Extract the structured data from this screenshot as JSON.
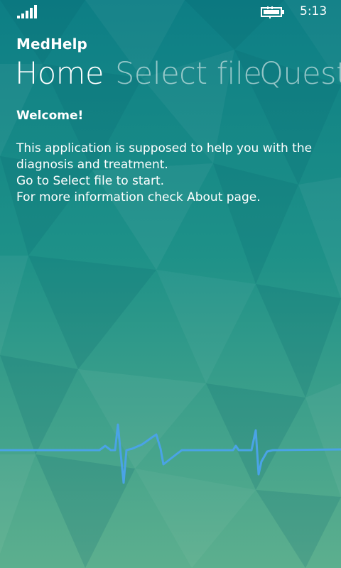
{
  "status_bar": {
    "time": "5:13",
    "signal_icon": "signal-strength-icon",
    "battery_icon": "battery-charging-icon"
  },
  "app": {
    "title": "MedHelp"
  },
  "pivot": {
    "items": [
      {
        "label": "Home",
        "active": true
      },
      {
        "label": "Select file",
        "active": false
      },
      {
        "label": "Quest",
        "active": false
      }
    ]
  },
  "home": {
    "welcome": "Welcome!",
    "lines": [
      "This application is supposed to help you with the",
      "diagnosis and treatment.",
      "Go to Select file to start.",
      "For more information check About page."
    ]
  },
  "theme": {
    "background_top": "#0e7f86",
    "background_bottom": "#5fb08f",
    "ecg_color": "#4aa3e6"
  },
  "decoration": {
    "ecg_icon": "ecg-heartbeat-line"
  }
}
